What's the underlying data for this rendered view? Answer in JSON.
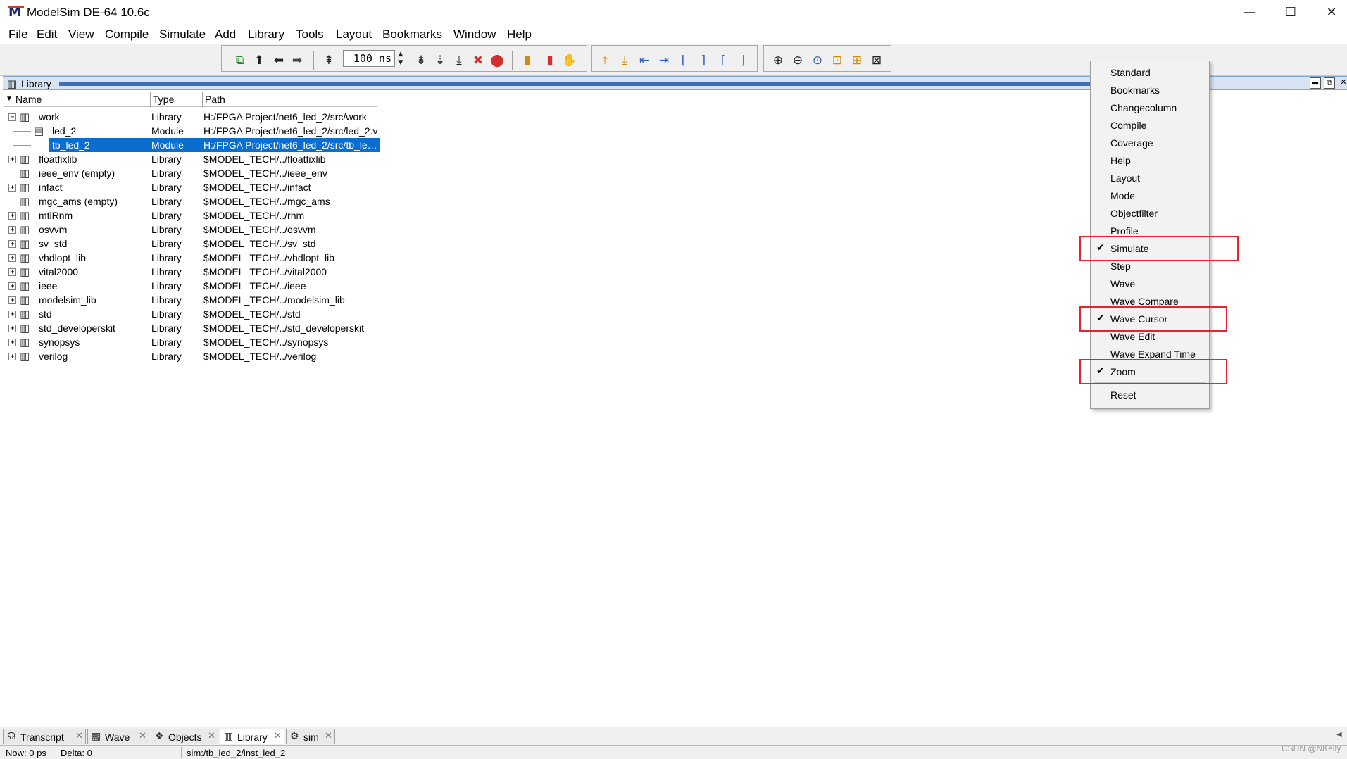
{
  "window": {
    "title": "ModelSim DE-64 10.6c",
    "logo_letter": "M",
    "controls": {
      "minimize": "—",
      "maximize": "☐",
      "close": "✕"
    }
  },
  "menubar": [
    "File",
    "Edit",
    "View",
    "Compile",
    "Simulate",
    "Add",
    "Library",
    "Tools",
    "Layout",
    "Bookmarks",
    "Window",
    "Help"
  ],
  "toolbar": {
    "run_length_value": "100 ns",
    "icons": [
      "compile-all-icon",
      "up-arrow-icon",
      "back-arrow-icon",
      "forward-arrow-icon",
      "restart-icon",
      "run-icon",
      "continue-run-icon",
      "run-all-icon",
      "break-icon",
      "stop-icon",
      "performance-profile-icon",
      "memory-profile-icon",
      "hand-icon",
      "find-previous-transition-icon",
      "find-next-transition-icon",
      "cursor-left-icon",
      "cursor-right-icon",
      "edge-falling-icon",
      "edge-rising-icon",
      "edge-previous-icon",
      "edge-next-icon",
      "zoom-in-icon",
      "zoom-out-icon",
      "zoom-full-icon",
      "zoom-cursor-icon",
      "zoom-mode-icon",
      "zoom-region-icon"
    ]
  },
  "library_panel": {
    "title": "Library",
    "columns": {
      "name": "Name",
      "type": "Type",
      "path": "Path"
    },
    "rows": [
      {
        "name": "work",
        "type": "Library",
        "path": "H:/FPGA Project/net6_led_2/src/work",
        "expander": "−",
        "level": 0,
        "icon": "library-icon"
      },
      {
        "name": "led_2",
        "type": "Module",
        "path": "H:/FPGA Project/net6_led_2/src/led_2.v",
        "expander": "",
        "level": 1,
        "icon": "module-icon"
      },
      {
        "name": "tb_led_2",
        "type": "Module",
        "path": "H:/FPGA Project/net6_led_2/src/tb_le…",
        "expander": "",
        "level": 1,
        "icon": "module-icon",
        "selected": true
      },
      {
        "name": "floatfixlib",
        "type": "Library",
        "path": "$MODEL_TECH/../floatfixlib",
        "expander": "+",
        "level": 0,
        "icon": "library-icon"
      },
      {
        "name": "ieee_env  (empty)",
        "type": "Library",
        "path": "$MODEL_TECH/../ieee_env",
        "expander": "",
        "level": 0,
        "icon": "library-icon"
      },
      {
        "name": "infact",
        "type": "Library",
        "path": "$MODEL_TECH/../infact",
        "expander": "+",
        "level": 0,
        "icon": "library-icon"
      },
      {
        "name": "mgc_ams  (empty)",
        "type": "Library",
        "path": "$MODEL_TECH/../mgc_ams",
        "expander": "",
        "level": 0,
        "icon": "library-icon"
      },
      {
        "name": "mtiRnm",
        "type": "Library",
        "path": "$MODEL_TECH/../rnm",
        "expander": "+",
        "level": 0,
        "icon": "library-icon"
      },
      {
        "name": "osvvm",
        "type": "Library",
        "path": "$MODEL_TECH/../osvvm",
        "expander": "+",
        "level": 0,
        "icon": "library-icon"
      },
      {
        "name": "sv_std",
        "type": "Library",
        "path": "$MODEL_TECH/../sv_std",
        "expander": "+",
        "level": 0,
        "icon": "library-icon"
      },
      {
        "name": "vhdlopt_lib",
        "type": "Library",
        "path": "$MODEL_TECH/../vhdlopt_lib",
        "expander": "+",
        "level": 0,
        "icon": "library-icon"
      },
      {
        "name": "vital2000",
        "type": "Library",
        "path": "$MODEL_TECH/../vital2000",
        "expander": "+",
        "level": 0,
        "icon": "library-icon"
      },
      {
        "name": "ieee",
        "type": "Library",
        "path": "$MODEL_TECH/../ieee",
        "expander": "+",
        "level": 0,
        "icon": "library-icon"
      },
      {
        "name": "modelsim_lib",
        "type": "Library",
        "path": "$MODEL_TECH/../modelsim_lib",
        "expander": "+",
        "level": 0,
        "icon": "library-icon"
      },
      {
        "name": "std",
        "type": "Library",
        "path": "$MODEL_TECH/../std",
        "expander": "+",
        "level": 0,
        "icon": "library-icon"
      },
      {
        "name": "std_developerskit",
        "type": "Library",
        "path": "$MODEL_TECH/../std_developerskit",
        "expander": "+",
        "level": 0,
        "icon": "library-icon"
      },
      {
        "name": "synopsys",
        "type": "Library",
        "path": "$MODEL_TECH/../synopsys",
        "expander": "+",
        "level": 0,
        "icon": "library-icon"
      },
      {
        "name": "verilog",
        "type": "Library",
        "path": "$MODEL_TECH/../verilog",
        "expander": "+",
        "level": 0,
        "icon": "library-icon"
      }
    ]
  },
  "context_menu": {
    "items": [
      {
        "label": "Standard",
        "checked": false
      },
      {
        "label": "Bookmarks",
        "checked": false
      },
      {
        "label": "Changecolumn",
        "checked": false
      },
      {
        "label": "Compile",
        "checked": false
      },
      {
        "label": "Coverage",
        "checked": false
      },
      {
        "label": "Help",
        "checked": false
      },
      {
        "label": "Layout",
        "checked": false
      },
      {
        "label": "Mode",
        "checked": false
      },
      {
        "label": "Objectfilter",
        "checked": false
      },
      {
        "label": "Profile",
        "checked": false
      },
      {
        "label": "Simulate",
        "checked": true,
        "highlighted": true
      },
      {
        "label": "Step",
        "checked": false
      },
      {
        "label": "Wave",
        "checked": false
      },
      {
        "label": "Wave Compare",
        "checked": false
      },
      {
        "label": "Wave Cursor",
        "checked": true,
        "highlighted": true
      },
      {
        "label": "Wave Edit",
        "checked": false
      },
      {
        "label": "Wave Expand Time",
        "checked": false
      },
      {
        "label": "Zoom",
        "checked": true,
        "highlighted": true
      }
    ],
    "reset_label": "Reset",
    "check_glyph": "✔",
    "highlight_color": "#e2242c"
  },
  "bottom_tabs": [
    {
      "label": "Transcript",
      "icon": "transcript-icon",
      "active": false
    },
    {
      "label": "Wave",
      "icon": "wave-icon",
      "active": false
    },
    {
      "label": "Objects",
      "icon": "objects-icon",
      "active": false
    },
    {
      "label": "Library",
      "icon": "library-icon",
      "active": true
    },
    {
      "label": "sim",
      "icon": "sim-icon",
      "active": false
    }
  ],
  "status_bar": {
    "now": "Now: 0 ps",
    "delta": "Delta: 0",
    "context": "sim:/tb_led_2/inst_led_2"
  },
  "watermark": "CSDN @NKelly",
  "colors": {
    "selection": "#0a6ed1",
    "panel_header": "#d7e3f3",
    "highlight_box": "#e2242c"
  }
}
